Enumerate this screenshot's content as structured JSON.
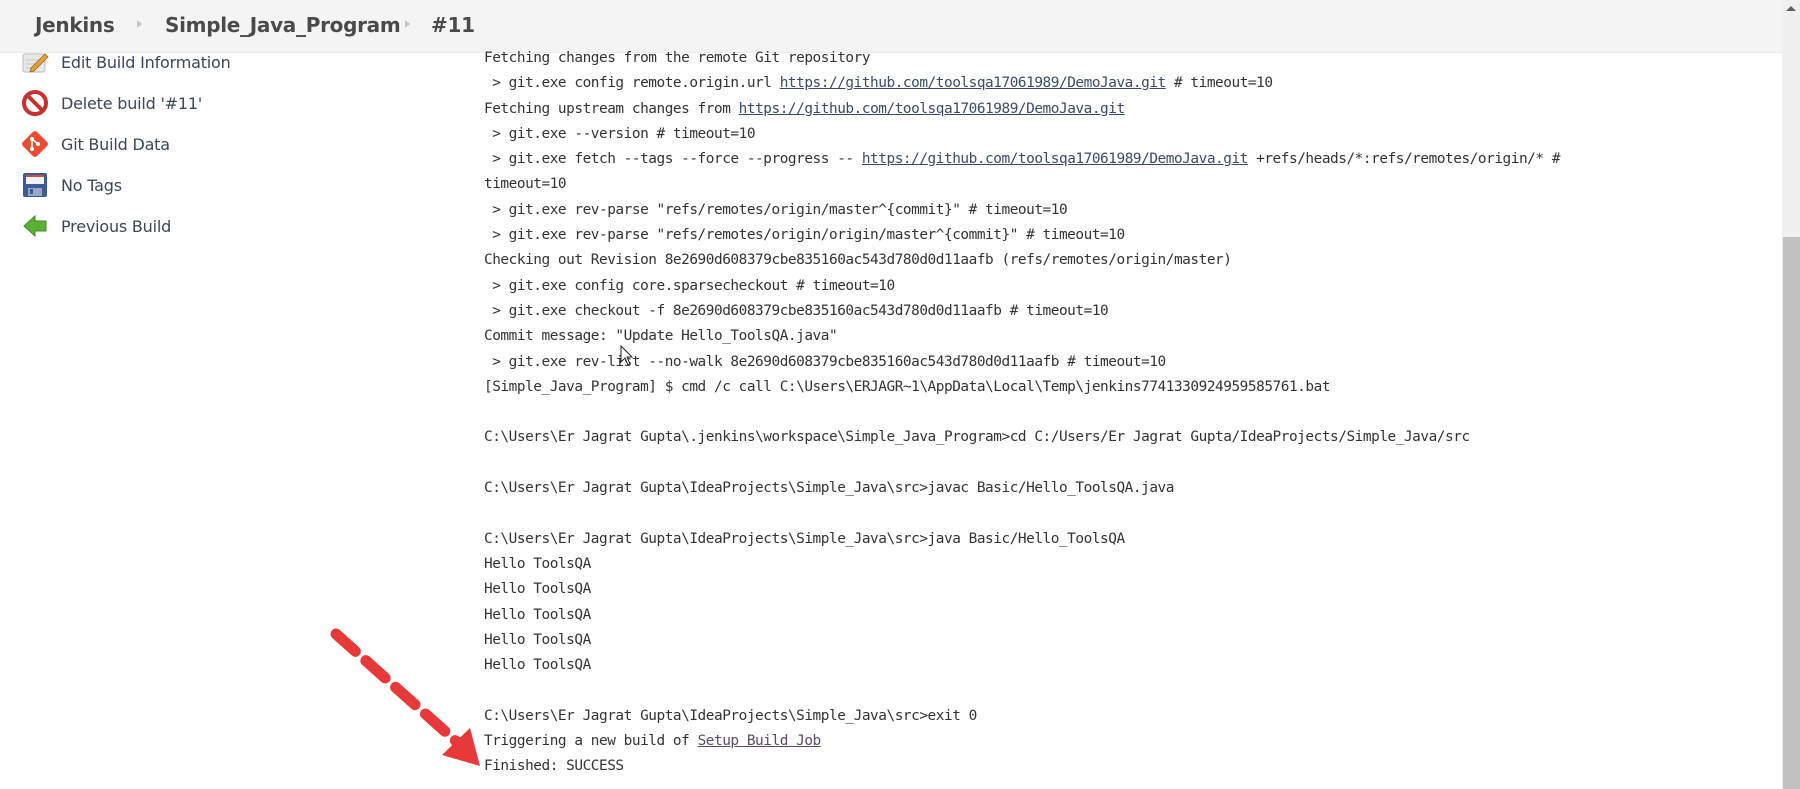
{
  "breadcrumb": [
    {
      "label": "Jenkins"
    },
    {
      "label": "Simple_Java_Program"
    },
    {
      "label": "#11"
    }
  ],
  "sidebar": {
    "items": [
      {
        "label": "Edit Build Information",
        "icon": "notepad-pencil-icon"
      },
      {
        "label": "Delete build '#11'",
        "icon": "no-entry-icon"
      },
      {
        "label": "Git Build Data",
        "icon": "git-logo-icon"
      },
      {
        "label": "No Tags",
        "icon": "floppy-disk-icon"
      },
      {
        "label": "Previous Build",
        "icon": "green-left-arrow-icon"
      }
    ]
  },
  "console": {
    "lines": [
      {
        "segments": [
          {
            "text": "Fetching changes from the remote Git repository"
          }
        ]
      },
      {
        "segments": [
          {
            "text": " > git.exe config remote.origin.url "
          },
          {
            "text": "https://github.com/toolsqa17061989/DemoJava.git",
            "link": true
          },
          {
            "text": " # timeout=10"
          }
        ]
      },
      {
        "segments": [
          {
            "text": "Fetching upstream changes from "
          },
          {
            "text": "https://github.com/toolsqa17061989/DemoJava.git",
            "link": true
          }
        ]
      },
      {
        "segments": [
          {
            "text": " > git.exe --version # timeout=10"
          }
        ]
      },
      {
        "segments": [
          {
            "text": " > git.exe fetch --tags --force --progress -- "
          },
          {
            "text": "https://github.com/toolsqa17061989/DemoJava.git",
            "link": true
          },
          {
            "text": " +refs/heads/*:refs/remotes/origin/* #"
          }
        ]
      },
      {
        "segments": [
          {
            "text": "timeout=10"
          }
        ]
      },
      {
        "segments": [
          {
            "text": " > git.exe rev-parse \"refs/remotes/origin/master^{commit}\" # timeout=10"
          }
        ]
      },
      {
        "segments": [
          {
            "text": " > git.exe rev-parse \"refs/remotes/origin/origin/master^{commit}\" # timeout=10"
          }
        ]
      },
      {
        "segments": [
          {
            "text": "Checking out Revision 8e2690d608379cbe835160ac543d780d0d11aafb (refs/remotes/origin/master)"
          }
        ]
      },
      {
        "segments": [
          {
            "text": " > git.exe config core.sparsecheckout # timeout=10"
          }
        ]
      },
      {
        "segments": [
          {
            "text": " > git.exe checkout -f 8e2690d608379cbe835160ac543d780d0d11aafb # timeout=10"
          }
        ]
      },
      {
        "segments": [
          {
            "text": "Commit message: \"Update Hello_ToolsQA.java\""
          }
        ]
      },
      {
        "segments": [
          {
            "text": " > git.exe rev-list --no-walk 8e2690d608379cbe835160ac543d780d0d11aafb # timeout=10"
          }
        ]
      },
      {
        "segments": [
          {
            "text": "[Simple_Java_Program] $ cmd /c call C:\\Users\\ERJAGR~1\\AppData\\Local\\Temp\\jenkins7741330924959585761.bat"
          }
        ]
      },
      {
        "segments": [
          {
            "text": ""
          }
        ]
      },
      {
        "segments": [
          {
            "text": "C:\\Users\\Er Jagrat Gupta\\.jenkins\\workspace\\Simple_Java_Program>cd C:/Users/Er Jagrat Gupta/IdeaProjects/Simple_Java/src"
          }
        ]
      },
      {
        "segments": [
          {
            "text": ""
          }
        ]
      },
      {
        "segments": [
          {
            "text": "C:\\Users\\Er Jagrat Gupta\\IdeaProjects\\Simple_Java\\src>javac Basic/Hello_ToolsQA.java"
          }
        ]
      },
      {
        "segments": [
          {
            "text": ""
          }
        ]
      },
      {
        "segments": [
          {
            "text": "C:\\Users\\Er Jagrat Gupta\\IdeaProjects\\Simple_Java\\src>java Basic/Hello_ToolsQA"
          }
        ]
      },
      {
        "segments": [
          {
            "text": "Hello ToolsQA"
          }
        ]
      },
      {
        "segments": [
          {
            "text": "Hello ToolsQA"
          }
        ]
      },
      {
        "segments": [
          {
            "text": "Hello ToolsQA"
          }
        ]
      },
      {
        "segments": [
          {
            "text": "Hello ToolsQA"
          }
        ]
      },
      {
        "segments": [
          {
            "text": "Hello ToolsQA"
          }
        ]
      },
      {
        "segments": [
          {
            "text": ""
          }
        ]
      },
      {
        "segments": [
          {
            "text": "C:\\Users\\Er Jagrat Gupta\\IdeaProjects\\Simple_Java\\src>exit 0"
          }
        ]
      },
      {
        "segments": [
          {
            "text": "Triggering a new build of "
          },
          {
            "text": "Setup Build Job",
            "link": true,
            "visited": true
          }
        ]
      },
      {
        "segments": [
          {
            "text": "Finished: SUCCESS"
          }
        ]
      }
    ]
  },
  "annotation": {
    "type": "dashed-arrow",
    "color": "#e8393a",
    "points_to": "Finished: SUCCESS"
  },
  "colors": {
    "header_bg": "#f4f4f4",
    "link": "#3b4a66",
    "visited_link": "#5c4a66",
    "text": "#333333"
  }
}
